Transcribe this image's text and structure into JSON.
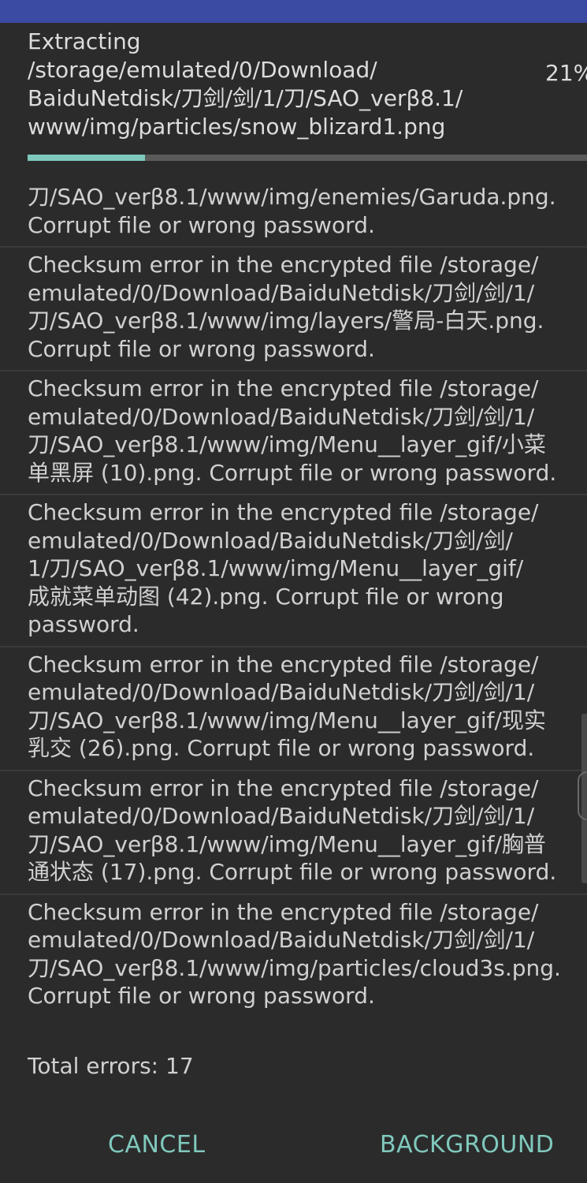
{
  "status": {
    "operation": "Extracting",
    "current_path": "/storage/emulated/0/Download/\nBaiduNetdisk/刀剑/剑/1/刀/SAO_verβ8.1/\nwww/img/particles/snow_blizard1.png",
    "percent_label": "21%",
    "progress": 0.21
  },
  "errors": [
    "刀/SAO_verβ8.1/www/img/enemies/Garuda.png.\nCorrupt file or wrong password.",
    "Checksum error in the encrypted file /storage/\nemulated/0/Download/BaiduNetdisk/刀剑/剑/1/\n刀/SAO_verβ8.1/www/img/layers/警局-白天.png.\nCorrupt file or wrong password.",
    "Checksum error in the encrypted file /storage/\nemulated/0/Download/BaiduNetdisk/刀剑/剑/1/\n刀/SAO_verβ8.1/www/img/Menu__layer_gif/小菜\n单黑屏 (10).png. Corrupt file or wrong password.",
    "Checksum error in the encrypted file /storage/\nemulated/0/Download/BaiduNetdisk/刀剑/剑/\n1/刀/SAO_verβ8.1/www/img/Menu__layer_gif/\n成就菜单动图 (42).png. Corrupt file or wrong\npassword.",
    "Checksum error in the encrypted file /storage/\nemulated/0/Download/BaiduNetdisk/刀剑/剑/1/\n刀/SAO_verβ8.1/www/img/Menu__layer_gif/现实\n乳交 (26).png. Corrupt file or wrong password.",
    "Checksum error in the encrypted file /storage/\nemulated/0/Download/BaiduNetdisk/刀剑/剑/1/\n刀/SAO_verβ8.1/www/img/Menu__layer_gif/胸普\n通状态 (17).png. Corrupt file or wrong password.",
    "Checksum error in the encrypted file /storage/\nemulated/0/Download/BaiduNetdisk/刀剑/剑/1/\n刀/SAO_verβ8.1/www/img/particles/cloud3s.png.\nCorrupt file or wrong password."
  ],
  "total_errors": "Total errors: 17",
  "buttons": {
    "cancel": "CANCEL",
    "background": "BACKGROUND"
  },
  "colors": {
    "accent": "#7fc8bd",
    "topbar": "#3b4aa3",
    "background": "#2b2b2b"
  }
}
